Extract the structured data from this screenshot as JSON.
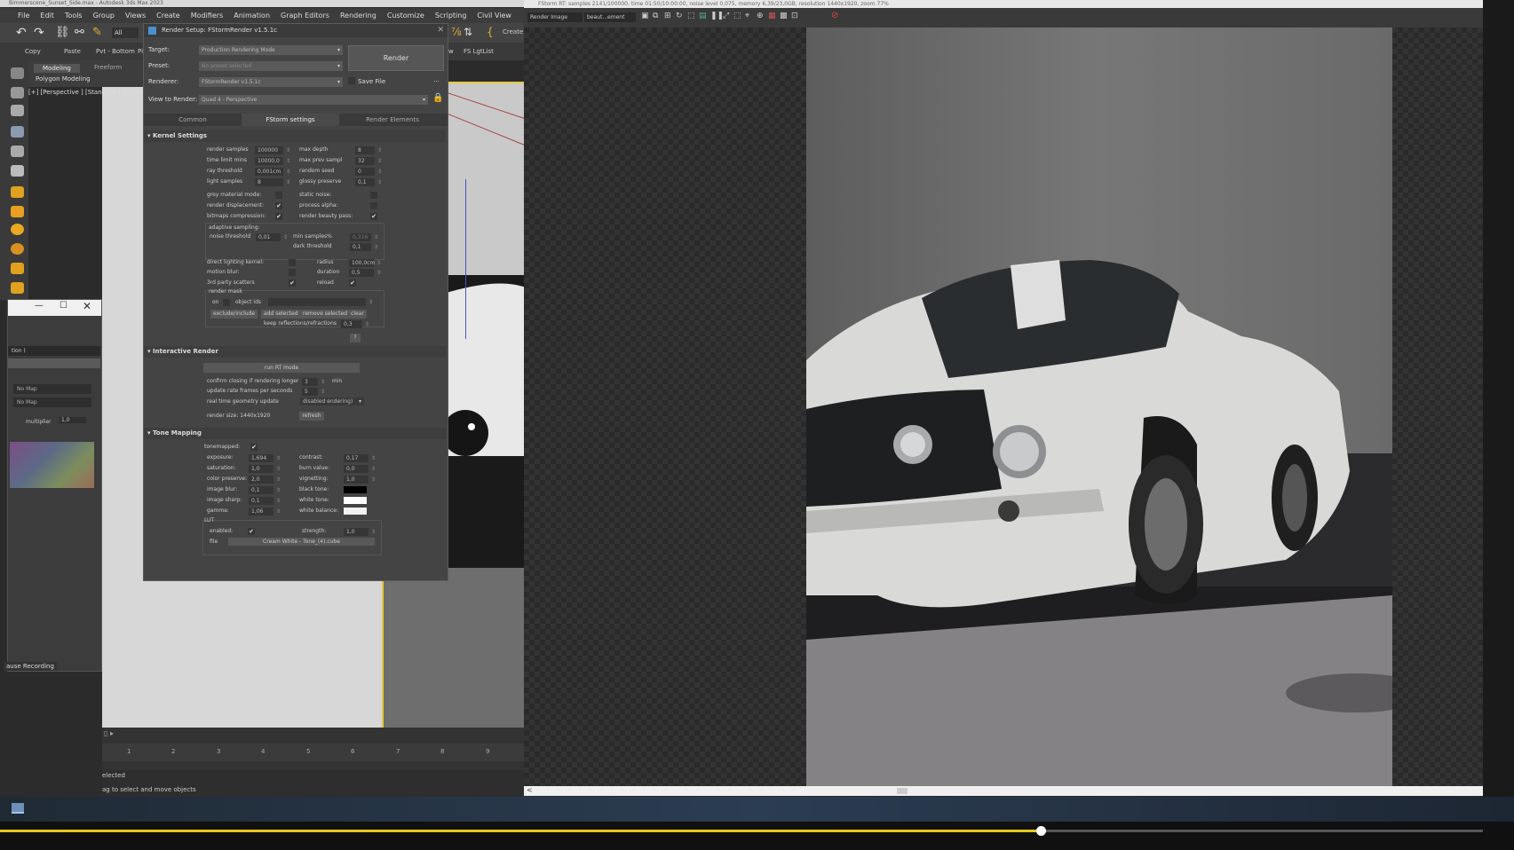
{
  "max": {
    "title": "Bimmerscene_Sunset_Side.max - Autodesk 3ds Max 2023",
    "menu": [
      "File",
      "Edit",
      "Tools",
      "Group",
      "Views",
      "Create",
      "Modifiers",
      "Animation",
      "Graph Editors",
      "Rendering",
      "Customize",
      "Scripting",
      "Civil View"
    ],
    "toolbar": {
      "selection_filter": "All",
      "create_label": "Create"
    },
    "toolbar2": {
      "copy": "Copy",
      "paste": "Paste",
      "pivot": "Pvt - Bottom",
      "pi": "Pi",
      "w": "w",
      "fs_lgtlist": "FS LgtList"
    },
    "ribbon": {
      "tab_modeling": "Modeling",
      "tab_freeform": "Freeform",
      "sub": "Polygon Modeling"
    },
    "viewport_label": "[+] [Perspective ] [Standard ] [Default",
    "timeline_ticks": [
      "1",
      "2",
      "3",
      "4",
      "5",
      "6",
      "7",
      "8",
      "9"
    ],
    "status_selected": "elected",
    "status_hint": "ag to select and move objects",
    "pause_recording": "ause Recording"
  },
  "mat_editor": {
    "dropdown": "tion )",
    "map1": "No Map",
    "map2": "No Map",
    "multiplier_label": "multiplier",
    "multiplier_value": "1,0"
  },
  "render_setup": {
    "title": "Render Setup: FStormRender v1.5.1c",
    "target_label": "Target:",
    "target_value": "Production Rendering Mode",
    "preset_label": "Preset:",
    "preset_value": "No preset selected",
    "renderer_label": "Renderer:",
    "renderer_value": "FStormRender v1.5.1c",
    "save_file": "Save File",
    "view_label": "View to Render:",
    "view_value": "Quad 4 - Perspective",
    "render_button": "Render",
    "tabs": [
      "Common",
      "FStorm settings",
      "Render Elements"
    ],
    "kernel": {
      "heading": "Kernel Settings",
      "render_samples": "render samples",
      "render_samples_v": "100000",
      "time_limit": "time limit mins",
      "time_limit_v": "10000,0",
      "ray_threshold": "ray threshold",
      "ray_threshold_v": "0,001cm",
      "light_samples": "light samples",
      "light_samples_v": "8",
      "max_depth": "max depth",
      "max_depth_v": "8",
      "max_prev": "max prev sampl",
      "max_prev_v": "32",
      "random_seed": "random seed",
      "random_seed_v": "0",
      "glossy_preserve": "glossy preserve",
      "glossy_preserve_v": "0,1",
      "grey_material": "grey material mode:",
      "render_displacement": "render displacement:",
      "bitmaps_compression": "bitmaps compression:",
      "static_noise": "static noise:",
      "process_alpha": "process alpha:",
      "render_beauty": "render beauty pass:",
      "adaptive": "adaptive sampling:",
      "noise_threshold": "noise threshold",
      "noise_threshold_v": "0,01",
      "min_samples": "min samples%",
      "min_samples_v": "0,316",
      "dark_threshold": "dark threshold",
      "dark_threshold_v": "0,1",
      "direct_lighting": "direct lighting kernel:",
      "motion_blur": "motion blur:",
      "third_party": "3rd party scatters",
      "radius": "radius",
      "radius_v": "100,0cm",
      "duration": "duration",
      "duration_v": "0,5",
      "reload": "reload",
      "render_mask": "render mask",
      "on": "on",
      "object_ids": "object ids",
      "exclude_include": "exclude/include",
      "add_selected": "add selected",
      "remove_selected": "remove selected",
      "clear": "clear",
      "keep_reflections": "keep reflections/refractions",
      "keep_reflections_v": "0,3",
      "help": "?"
    },
    "interactive": {
      "heading": "Interactive Render",
      "run_rt": "run RT mode",
      "confirm_closing": "confirm closing if rendering longer",
      "confirm_v": "3",
      "confirm_unit": "min",
      "update_rate": "update rate frames per seconds",
      "update_v": "5",
      "realtime_geo": "real time geometry update",
      "realtime_geo_v": "disabled   endering)",
      "render_size": "render size: 1440x1920",
      "refresh": "refresh"
    },
    "tone": {
      "heading": "Tone Mapping",
      "tonemapped": "tonemapped:",
      "exposure": "exposure:",
      "exposure_v": "1,694",
      "saturation": "saturation:",
      "saturation_v": "1,0",
      "color_preserve": "color preserve:",
      "color_preserve_v": "2,0",
      "image_blur": "image blur:",
      "image_blur_v": "0,1",
      "image_sharp": "image sharp:",
      "image_sharp_v": "0,1",
      "gamma": "gamma:",
      "gamma_v": "1,06",
      "contrast": "contrast:",
      "contrast_v": "0,17",
      "burn_value": "burn value:",
      "burn_value_v": "0,0",
      "vignetting": "vignetting:",
      "vignetting_v": "1,0",
      "black_tone": "black tone:",
      "white_tone": "white tone:",
      "white_balance": "white balance:",
      "lut": "LUT",
      "lut_enabled": "enabled:",
      "strength": "strength:",
      "strength_v": "1,0",
      "file": "file",
      "file_v": "Cream White - Tone_(4).cube"
    }
  },
  "render_frame": {
    "title": "FStorm RT: samples 2141/100000, time 01:50/10:00:00, noise level 0,075, memory 6,39/23,0GB, resolution 1440x1920, zoom 77%",
    "channel": "Render Image",
    "element": "beaut...ement"
  },
  "player": {
    "progress": 0.702
  },
  "colors": {
    "accent": "#e8c71b",
    "viewport_border": "#e6c93b"
  }
}
